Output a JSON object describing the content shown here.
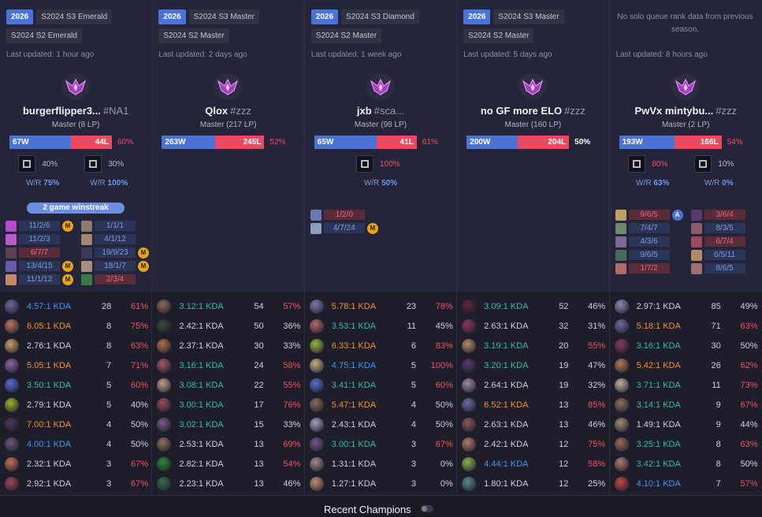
{
  "colors": {
    "blue": "#4b73d6",
    "red": "#e84a5f",
    "orange": "#f0902c",
    "teal": "#2dbfa3",
    "link_blue": "#3f95f2",
    "text": "#cfcfda"
  },
  "players": [
    {
      "badges": [
        "2026",
        "S2024 S3 Emerald",
        "S2024 S2 Emerald"
      ],
      "no_data": "",
      "updated": "Last updated: 1 hour ago",
      "name": "burgerflipper3...",
      "tag": "#NA1",
      "rank": "Master (8 LP)",
      "wins": "67W",
      "losses": "44L",
      "winrate": "60%",
      "winrate_color": "red",
      "win_fraction": 0.6,
      "roles": [
        {
          "icon": "jungle-role-icon",
          "pct": "40%",
          "wr_label": "W/R",
          "wr": "75%"
        },
        {
          "icon": "top-role-icon",
          "pct": "30%",
          "wr_label": "W/R",
          "wr": "100%"
        }
      ],
      "streak": "2 game winstreak",
      "recent": [
        {
          "kda": "11/2/6",
          "loss": false,
          "badge": "M",
          "color": "#b14bd0"
        },
        {
          "kda": "11/2/3",
          "loss": false,
          "badge": "",
          "color": "#b85dc8"
        },
        {
          "kda": "6/7/7",
          "loss": true,
          "badge": "",
          "color": "#5a4050"
        },
        {
          "kda": "13/4/15",
          "loss": false,
          "badge": "M",
          "color": "#6b5aa8"
        },
        {
          "kda": "11/1/12",
          "loss": false,
          "badge": "M",
          "color": "#c58a6b"
        },
        {
          "kda": "1/1/1",
          "loss": false,
          "badge": "",
          "color": "#8a7a70"
        },
        {
          "kda": "4/1/12",
          "loss": false,
          "badge": "",
          "color": "#a08870"
        },
        {
          "kda": "19/9/23",
          "loss": false,
          "badge": "M",
          "color": "#3a3a5a"
        },
        {
          "kda": "18/1/7",
          "loss": false,
          "badge": "M",
          "color": "#a89080"
        },
        {
          "kda": "2/3/4",
          "loss": true,
          "badge": "",
          "color": "#3a7a4a"
        }
      ],
      "champions": [
        {
          "kda": "4.57:1 KDA",
          "kda_color": "link_blue",
          "games": "28",
          "wr": "61%",
          "wr_color": "red",
          "color": "#6a6a9a"
        },
        {
          "kda": "6.05:1 KDA",
          "kda_color": "orange",
          "games": "8",
          "wr": "75%",
          "wr_color": "red",
          "color": "#b87860"
        },
        {
          "kda": "2.76:1 KDA",
          "kda_color": "text",
          "games": "8",
          "wr": "63%",
          "wr_color": "red",
          "color": "#c8a070"
        },
        {
          "kda": "5.05:1 KDA",
          "kda_color": "orange",
          "games": "7",
          "wr": "71%",
          "wr_color": "red",
          "color": "#8a6aa0"
        },
        {
          "kda": "3.50:1 KDA",
          "kda_color": "teal",
          "games": "5",
          "wr": "60%",
          "wr_color": "red",
          "color": "#5a6ad0"
        },
        {
          "kda": "2.79:1 KDA",
          "kda_color": "text",
          "games": "5",
          "wr": "40%",
          "wr_color": "text",
          "color": "#9ab030"
        },
        {
          "kda": "7.00:1 KDA",
          "kda_color": "orange",
          "games": "4",
          "wr": "50%",
          "wr_color": "text",
          "color": "#4a3a5a"
        },
        {
          "kda": "4.00:1 KDA",
          "kda_color": "link_blue",
          "games": "4",
          "wr": "50%",
          "wr_color": "text",
          "color": "#6a5a7a"
        },
        {
          "kda": "2.32:1 KDA",
          "kda_color": "text",
          "games": "3",
          "wr": "67%",
          "wr_color": "red",
          "color": "#c0705a"
        },
        {
          "kda": "2.92:1 KDA",
          "kda_color": "text",
          "games": "3",
          "wr": "67%",
          "wr_color": "red",
          "color": "#9a4a5a"
        }
      ]
    },
    {
      "badges": [
        "2026",
        "S2024 S3 Master",
        "S2024 S2 Master"
      ],
      "no_data": "",
      "updated": "Last updated: 2 days ago",
      "name": "Qlox",
      "tag": "#zzz",
      "rank": "Master (217 LP)",
      "wins": "263W",
      "losses": "245L",
      "winrate": "52%",
      "winrate_color": "red",
      "win_fraction": 0.52,
      "roles": [],
      "streak": "",
      "recent": [],
      "champions": [
        {
          "kda": "3.12:1 KDA",
          "kda_color": "teal",
          "games": "54",
          "wr": "57%",
          "wr_color": "red",
          "color": "#8a6a5a"
        },
        {
          "kda": "2.42:1 KDA",
          "kda_color": "text",
          "games": "50",
          "wr": "36%",
          "wr_color": "text",
          "color": "#3a4a3a"
        },
        {
          "kda": "2.37:1 KDA",
          "kda_color": "text",
          "games": "30",
          "wr": "33%",
          "wr_color": "text",
          "color": "#b07050"
        },
        {
          "kda": "3.16:1 KDA",
          "kda_color": "teal",
          "games": "24",
          "wr": "58%",
          "wr_color": "red",
          "color": "#a05a6a"
        },
        {
          "kda": "3.08:1 KDA",
          "kda_color": "teal",
          "games": "22",
          "wr": "55%",
          "wr_color": "red",
          "color": "#c0a08a"
        },
        {
          "kda": "3.00:1 KDA",
          "kda_color": "teal",
          "games": "17",
          "wr": "76%",
          "wr_color": "red",
          "color": "#9a4a5a"
        },
        {
          "kda": "3.02:1 KDA",
          "kda_color": "teal",
          "games": "15",
          "wr": "33%",
          "wr_color": "text",
          "color": "#7a5a8a"
        },
        {
          "kda": "2.53:1 KDA",
          "kda_color": "text",
          "games": "13",
          "wr": "69%",
          "wr_color": "red",
          "color": "#8a7060"
        },
        {
          "kda": "2.82:1 KDA",
          "kda_color": "text",
          "games": "13",
          "wr": "54%",
          "wr_color": "red",
          "color": "#2a8a3a"
        },
        {
          "kda": "2.23:1 KDA",
          "kda_color": "text",
          "games": "13",
          "wr": "46%",
          "wr_color": "text",
          "color": "#3a6a4a"
        }
      ]
    },
    {
      "badges": [
        "2026",
        "S2024 S3 Diamond",
        "S2024 S2 Master"
      ],
      "no_data": "",
      "updated": "Last updated: 1 week ago",
      "name": "jxb",
      "tag": "#sca...",
      "rank": "Master (98 LP)",
      "wins": "65W",
      "losses": "41L",
      "winrate": "61%",
      "winrate_color": "red",
      "win_fraction": 0.61,
      "roles": [
        {
          "icon": "mid-role-icon",
          "pct": "100%",
          "pct_color": "red",
          "wr_label": "W/R",
          "wr": "50%"
        }
      ],
      "streak": "",
      "recent": [
        {
          "kda": "1/2/0",
          "loss": true,
          "badge": "",
          "color": "#6a7ab0"
        },
        {
          "kda": "4/7/24",
          "loss": false,
          "badge": "M",
          "color": "#8aa0c0"
        }
      ],
      "champions": [
        {
          "kda": "5.78:1 KDA",
          "kda_color": "orange",
          "games": "23",
          "wr": "78%",
          "wr_color": "red",
          "color": "#7a7aa8"
        },
        {
          "kda": "3.53:1 KDA",
          "kda_color": "teal",
          "games": "11",
          "wr": "45%",
          "wr_color": "text",
          "color": "#b06a6a"
        },
        {
          "kda": "6.33:1 KDA",
          "kda_color": "orange",
          "games": "6",
          "wr": "83%",
          "wr_color": "red",
          "color": "#9ab040"
        },
        {
          "kda": "4.75:1 KDA",
          "kda_color": "link_blue",
          "games": "5",
          "wr": "100%",
          "wr_color": "red",
          "color": "#c0b080"
        },
        {
          "kda": "3.41:1 KDA",
          "kda_color": "teal",
          "games": "5",
          "wr": "60%",
          "wr_color": "red",
          "color": "#5a6ad0"
        },
        {
          "kda": "5.47:1 KDA",
          "kda_color": "orange",
          "games": "4",
          "wr": "50%",
          "wr_color": "text",
          "color": "#8a6a5a"
        },
        {
          "kda": "2.43:1 KDA",
          "kda_color": "text",
          "games": "4",
          "wr": "50%",
          "wr_color": "text",
          "color": "#a0a0b8"
        },
        {
          "kda": "3.00:1 KDA",
          "kda_color": "teal",
          "games": "3",
          "wr": "67%",
          "wr_color": "red",
          "color": "#6a5a8a"
        },
        {
          "kda": "1.31:1 KDA",
          "kda_color": "text",
          "games": "3",
          "wr": "0%",
          "wr_color": "text",
          "color": "#a08a8a"
        },
        {
          "kda": "1.27:1 KDA",
          "kda_color": "text",
          "games": "3",
          "wr": "0%",
          "wr_color": "text",
          "color": "#c09070"
        }
      ]
    },
    {
      "badges": [
        "2026",
        "S2024 S3 Master",
        "S2024 S2 Master"
      ],
      "no_data": "",
      "updated": "Last updated: 5 days ago",
      "name": "no GF more ELO",
      "tag": "#zzz",
      "rank": "Master (160 LP)",
      "wins": "200W",
      "losses": "204L",
      "winrate": "50%",
      "winrate_color": "white",
      "win_fraction": 0.5,
      "roles": [],
      "streak": "",
      "recent": [],
      "champions": [
        {
          "kda": "3.09:1 KDA",
          "kda_color": "teal",
          "games": "52",
          "wr": "46%",
          "wr_color": "text",
          "color": "#5a2a3a"
        },
        {
          "kda": "2.63:1 KDA",
          "kda_color": "text",
          "games": "32",
          "wr": "31%",
          "wr_color": "text",
          "color": "#8a3a5a"
        },
        {
          "kda": "3.19:1 KDA",
          "kda_color": "teal",
          "games": "20",
          "wr": "55%",
          "wr_color": "red",
          "color": "#b08a6a"
        },
        {
          "kda": "3.20:1 KDA",
          "kda_color": "teal",
          "games": "19",
          "wr": "47%",
          "wr_color": "text",
          "color": "#5a3a6a"
        },
        {
          "kda": "2.64:1 KDA",
          "kda_color": "text",
          "games": "19",
          "wr": "32%",
          "wr_color": "text",
          "color": "#a08a9a"
        },
        {
          "kda": "6.52:1 KDA",
          "kda_color": "orange",
          "games": "13",
          "wr": "85%",
          "wr_color": "red",
          "color": "#6a6aa0"
        },
        {
          "kda": "2.63:1 KDA",
          "kda_color": "text",
          "games": "13",
          "wr": "46%",
          "wr_color": "text",
          "color": "#8a5a5a"
        },
        {
          "kda": "2.42:1 KDA",
          "kda_color": "text",
          "games": "12",
          "wr": "75%",
          "wr_color": "red",
          "color": "#b07a6a"
        },
        {
          "kda": "4.44:1 KDA",
          "kda_color": "link_blue",
          "games": "12",
          "wr": "58%",
          "wr_color": "red",
          "color": "#8ab050"
        },
        {
          "kda": "1.80:1 KDA",
          "kda_color": "text",
          "games": "12",
          "wr": "25%",
          "wr_color": "text",
          "color": "#5a8a8a"
        }
      ]
    },
    {
      "badges": [],
      "no_data": "No solo queue rank data from previous season.",
      "updated": "Last updated: 8 hours ago",
      "name": "PwVx mintybu...",
      "tag": "#zzz",
      "rank": "Master (2 LP)",
      "wins": "193W",
      "losses": "166L",
      "winrate": "54%",
      "winrate_color": "red",
      "win_fraction": 0.54,
      "roles": [
        {
          "icon": "jungle-role-icon",
          "pct": "80%",
          "pct_color": "red",
          "wr_label": "W/R",
          "wr": "63%"
        },
        {
          "icon": "top-role-icon",
          "pct": "10%",
          "wr_label": "W/R",
          "wr": "0%"
        }
      ],
      "streak": "",
      "recent": [
        {
          "kda": "9/6/5",
          "loss": true,
          "badge": "A",
          "color": "#c0a060"
        },
        {
          "kda": "7/4/7",
          "loss": false,
          "badge": "",
          "color": "#6a8a6a"
        },
        {
          "kda": "4/3/6",
          "loss": false,
          "badge": "",
          "color": "#7a6a9a"
        },
        {
          "kda": "9/6/5",
          "loss": false,
          "badge": "",
          "color": "#4a6a5a"
        },
        {
          "kda": "1/7/2",
          "loss": true,
          "badge": "",
          "color": "#b06a6a"
        },
        {
          "kda": "3/6/4",
          "loss": true,
          "badge": "",
          "color": "#5a3a6a"
        },
        {
          "kda": "8/3/5",
          "loss": false,
          "badge": "",
          "color": "#8a5a6a"
        },
        {
          "kda": "6/7/4",
          "loss": true,
          "badge": "",
          "color": "#9a4a5a"
        },
        {
          "kda": "6/5/11",
          "loss": false,
          "badge": "",
          "color": "#b08a6a"
        },
        {
          "kda": "8/6/5",
          "loss": false,
          "badge": "",
          "color": "#a07070"
        }
      ],
      "champions": [
        {
          "kda": "2.97:1 KDA",
          "kda_color": "text",
          "games": "85",
          "wr": "49%",
          "wr_color": "text",
          "color": "#8a8ab0"
        },
        {
          "kda": "5.18:1 KDA",
          "kda_color": "orange",
          "games": "71",
          "wr": "63%",
          "wr_color": "red",
          "color": "#6a6aa0"
        },
        {
          "kda": "3.16:1 KDA",
          "kda_color": "teal",
          "games": "30",
          "wr": "50%",
          "wr_color": "text",
          "color": "#8a3a5a"
        },
        {
          "kda": "5.42:1 KDA",
          "kda_color": "orange",
          "games": "26",
          "wr": "62%",
          "wr_color": "red",
          "color": "#b07a5a"
        },
        {
          "kda": "3.71:1 KDA",
          "kda_color": "teal",
          "games": "11",
          "wr": "73%",
          "wr_color": "red",
          "color": "#c0b0a0"
        },
        {
          "kda": "3.14:1 KDA",
          "kda_color": "teal",
          "games": "9",
          "wr": "67%",
          "wr_color": "red",
          "color": "#8a7060"
        },
        {
          "kda": "1.49:1 KDA",
          "kda_color": "text",
          "games": "9",
          "wr": "44%",
          "wr_color": "text",
          "color": "#a08a7a"
        },
        {
          "kda": "3.25:1 KDA",
          "kda_color": "teal",
          "games": "8",
          "wr": "63%",
          "wr_color": "red",
          "color": "#9a6a5a"
        },
        {
          "kda": "3.42:1 KDA",
          "kda_color": "teal",
          "games": "8",
          "wr": "50%",
          "wr_color": "text",
          "color": "#b07a6a"
        },
        {
          "kda": "4.10:1 KDA",
          "kda_color": "link_blue",
          "games": "7",
          "wr": "57%",
          "wr_color": "red",
          "color": "#c04a4a"
        }
      ]
    }
  ],
  "footer": {
    "label": "Recent Champions",
    "toggle_on": false
  }
}
